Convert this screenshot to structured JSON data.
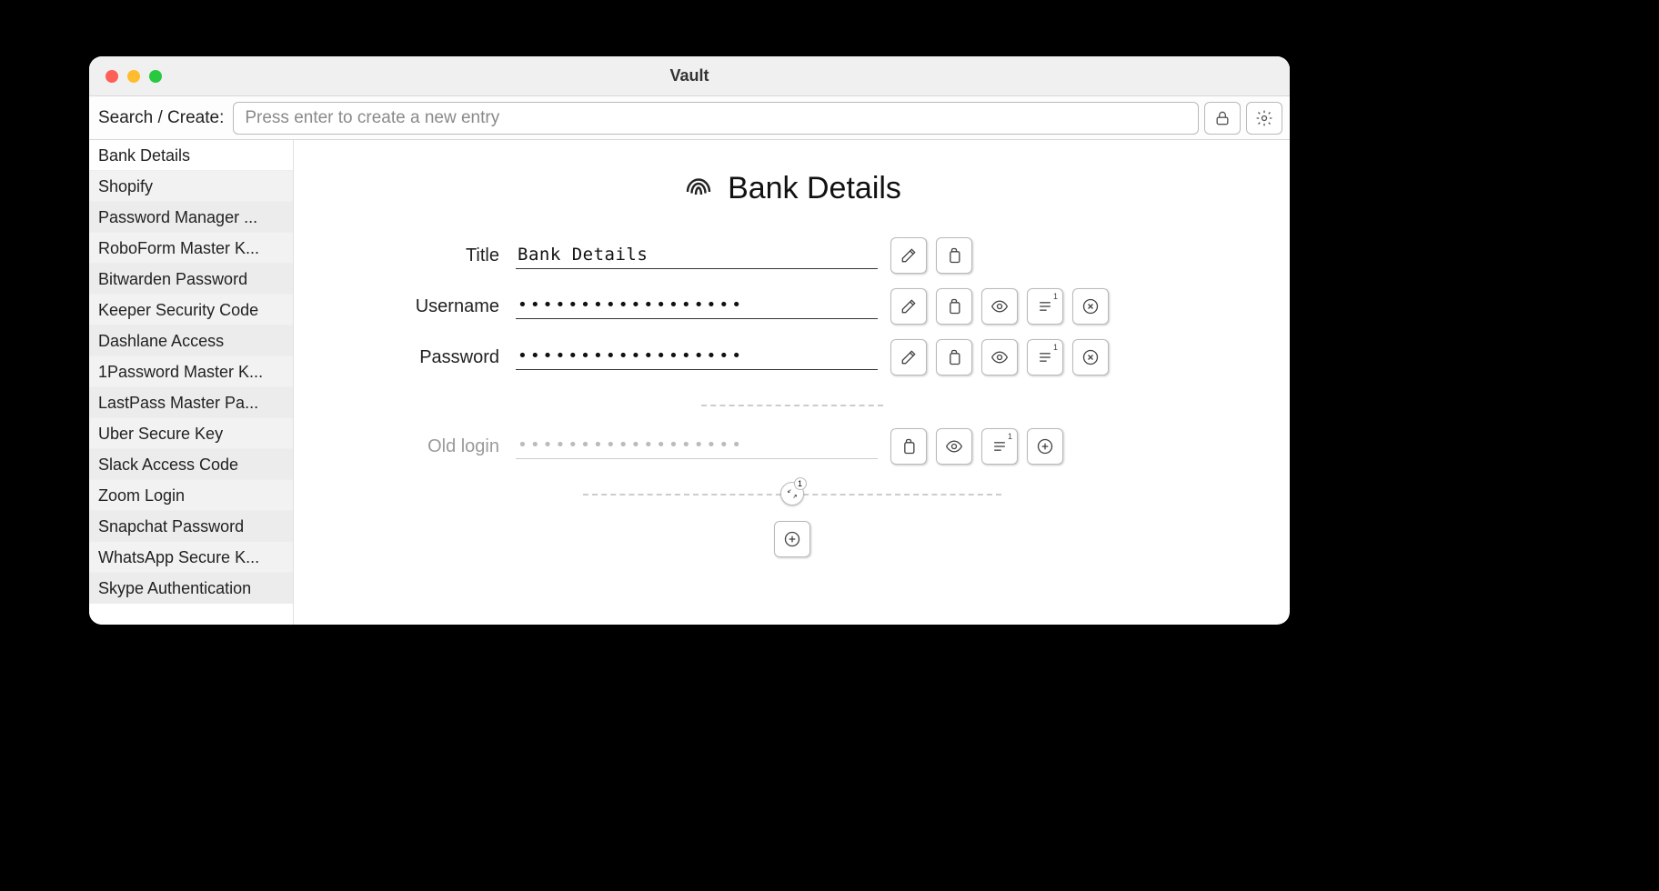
{
  "window": {
    "title": "Vault"
  },
  "toolbar": {
    "label": "Search / Create:",
    "placeholder": "Press enter to create a new entry"
  },
  "sidebar": {
    "selected_index": 0,
    "items": [
      "Bank Details",
      "Shopify",
      "Password Manager ...",
      "RoboForm Master K...",
      "Bitwarden Password",
      "Keeper Security Code",
      "Dashlane Access",
      "1Password Master K...",
      "LastPass Master Pa...",
      "Uber Secure Key",
      "Slack Access Code",
      "Zoom Login",
      "Snapchat Password",
      "WhatsApp Secure K...",
      "Skype Authentication"
    ]
  },
  "detail": {
    "header_title": "Bank Details",
    "collapse_count": "1",
    "fields": {
      "title": {
        "label": "Title",
        "value": "Bank Details",
        "masked": false,
        "actions": [
          "edit",
          "copy"
        ]
      },
      "username": {
        "label": "Username",
        "value": "••••••••••••••••••",
        "masked": true,
        "actions": [
          "edit",
          "copy",
          "reveal",
          "textarea",
          "clear"
        ]
      },
      "password": {
        "label": "Password",
        "value": "••••••••••••••••••",
        "masked": true,
        "actions": [
          "edit",
          "copy",
          "reveal",
          "textarea",
          "clear"
        ]
      },
      "oldlogin": {
        "label": "Old login",
        "value": "••••••••••••••••••",
        "masked": true,
        "actions": [
          "copy",
          "reveal",
          "textarea",
          "add"
        ],
        "archived": true
      }
    }
  }
}
